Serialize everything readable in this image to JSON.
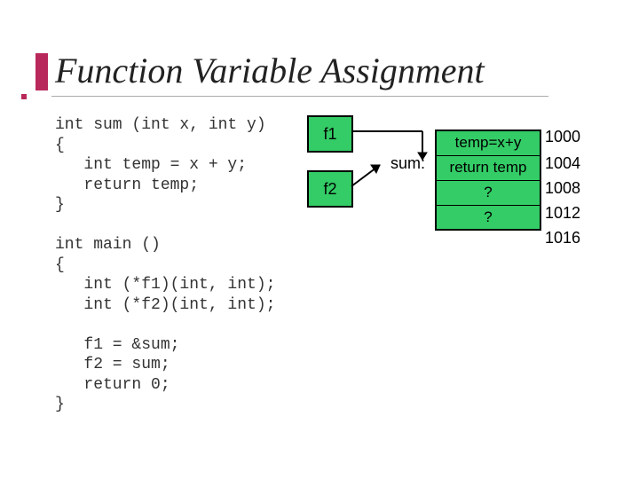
{
  "title": "Function Variable Assignment",
  "code": "int sum (int x, int y)\n{\n   int temp = x + y;\n   return temp;\n}\n\nint main ()\n{\n   int (*f1)(int, int);\n   int (*f2)(int, int);\n\n   f1 = &sum;\n   f2 = sum;\n   return 0;\n}",
  "boxes": {
    "f1": "f1",
    "f2": "f2"
  },
  "sum_label": "sum:",
  "table": {
    "rows": [
      "temp=x+y",
      "return temp",
      "?",
      "?"
    ]
  },
  "addresses": [
    "1000",
    "1004",
    "1008",
    "1012",
    "1016"
  ]
}
